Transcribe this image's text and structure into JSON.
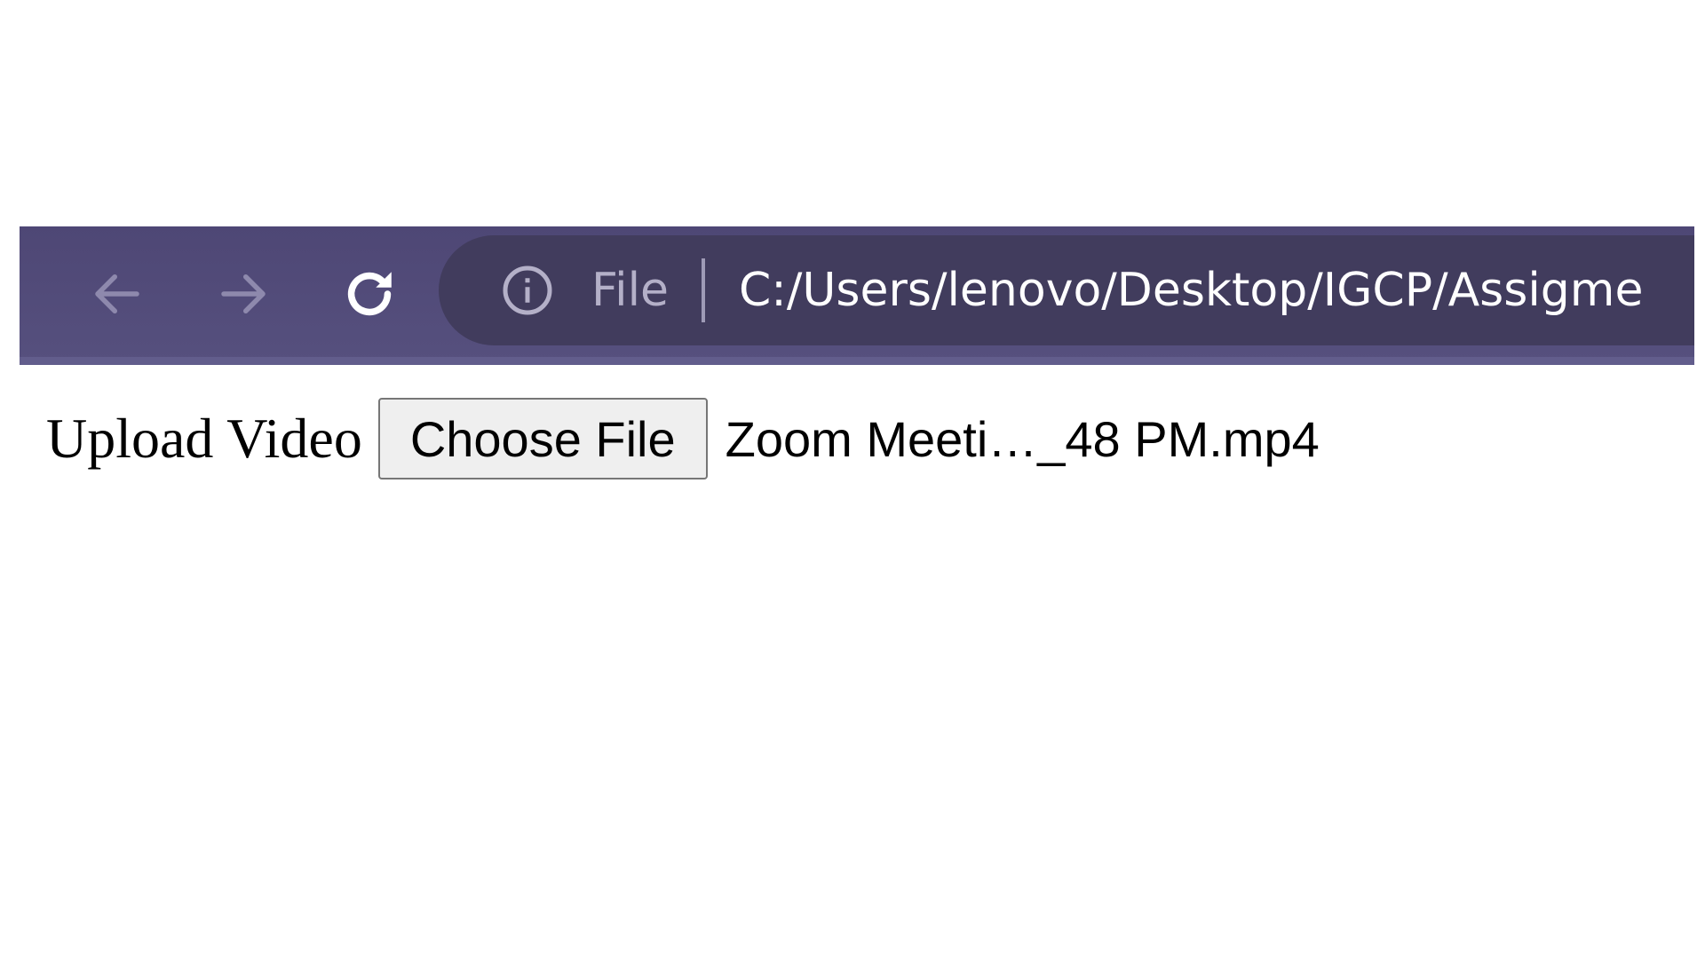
{
  "browser": {
    "nav": {
      "back_icon": "arrow-left-icon",
      "forward_icon": "arrow-right-icon",
      "reload_icon": "reload-icon"
    },
    "address_bar": {
      "info_icon": "info-icon",
      "scheme_label": "File",
      "url": "C:/Users/lenovo/Desktop/IGCP/Assigme"
    },
    "colors": {
      "toolbar": "#56507e",
      "omnibox": "#413c5d",
      "disabled_icon": "#8e89ad",
      "active_icon": "#ffffff"
    }
  },
  "page": {
    "upload_label": "Upload Video",
    "choose_file_label": "Choose File",
    "selected_file": "Zoom Meeti…_48 PM.mp4"
  }
}
